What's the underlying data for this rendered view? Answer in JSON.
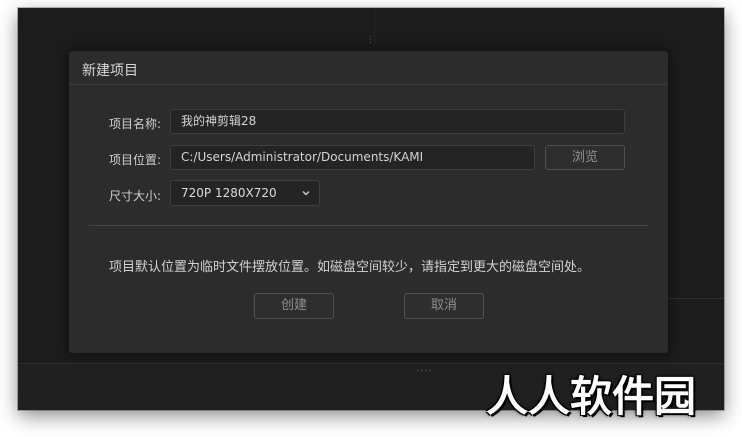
{
  "dialog": {
    "title": "新建项目",
    "project_name": {
      "label": "项目名称:",
      "value": "我的神剪辑28"
    },
    "project_location": {
      "label": "项目位置:",
      "value": "C:/Users/Administrator/Documents/KAMI",
      "browse_label": "浏览"
    },
    "size": {
      "label": "尺寸大小:",
      "selected": "720P 1280X720"
    },
    "hint": "项目默认位置为临时文件摆放位置。如磁盘空间较少，请指定到更大的磁盘空间处。",
    "create_label": "创建",
    "cancel_label": "取消"
  },
  "app": {
    "grip_top": "⋮",
    "grip_bottom": "····"
  },
  "watermark": "人人软件园"
}
